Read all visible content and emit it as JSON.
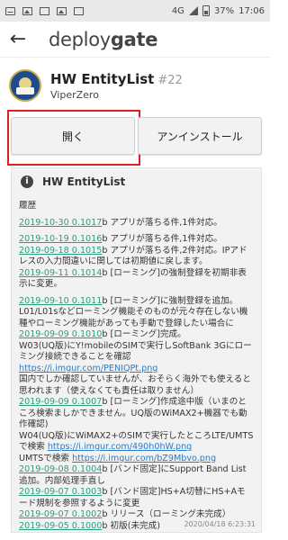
{
  "status_bar": {
    "network": "4G",
    "battery": "37%",
    "time": "17:06"
  },
  "app_bar": {
    "logo_plain": "deploy",
    "logo_bold": "gate"
  },
  "app": {
    "name": "HW EntityList",
    "number": "#22",
    "org": "ViperZero"
  },
  "actions": {
    "open_label": "開く",
    "uninstall_label": "アンインストール"
  },
  "card": {
    "title": "HW EntityList",
    "history_label": "履歴",
    "entries": [
      {
        "link": "2019-10-30 0.1017",
        "text": "b アプリが落ちる件,1件対応。"
      },
      {
        "link": "2019-10-19 0.1016",
        "text": "b アプリが落ちる件,1件対応。"
      },
      {
        "link": "2019-09-18 0.1015",
        "text": "b アプリが落ちる件,2件対応。IPアドレスの入力間違いに関しては初期値に戻します。"
      },
      {
        "link": "2019-09-11 0.1014",
        "text": "b [ローミング]の強制登録を初期非表示に変更。"
      },
      {
        "link": "2019-09-10 0.1011",
        "text": "b [ローミング]に強制登録を追加。L01/L01sなどローミング機能そのものが元々存在しない機種やローミング機能があっても手動で登録したい場合に"
      },
      {
        "link": "2019-09-09 0.1010",
        "text": "b [ローミング]完成。"
      },
      {
        "link": "",
        "text": "W03(UQ版)にY!mobileのSIMで実行しSoftBank 3Gにローミング接続できることを確認"
      },
      {
        "link": "https://i.imgur.com/PENIQPt.png",
        "text": ""
      },
      {
        "link": "",
        "text": "国内でしか確認していませんが、おそらく海外でも使えると思われます（使えなくても責任は取りません）"
      },
      {
        "link": "2019-09-09 0.1007",
        "text": "b [ローミング]作成途中版（いまのところ検索ましかできません。UQ版のWiMAX2+機器でも動作確認)"
      },
      {
        "link": "",
        "text": "W04(UQ版)にWiMAX2+のSIMで実行したところLTE/UMTSで検索"
      },
      {
        "link": "https://i.imgur.com/490h0hW.png",
        "text": ""
      },
      {
        "link": "",
        "text": "UMTSで検索"
      },
      {
        "link": "https://i.imgur.com/bZ9Mbvo.png",
        "text": ""
      },
      {
        "link": "2019-09-08 0.1004",
        "text": "b [バンド固定]にSupport Band List追加。内部処理手直し"
      },
      {
        "link": "2019-09-07 0.1003",
        "text": "b [バンド固定]HS+A切替にHS+Aモード規制を参照するように変更"
      },
      {
        "link": "2019-09-07 0.1002",
        "text": "b リリース（ローミング未完成）"
      },
      {
        "link": "2019-09-05 0.1000",
        "text": "b 初版(未完成)"
      }
    ],
    "timestamp": "2020/04/18 6:23:31"
  }
}
